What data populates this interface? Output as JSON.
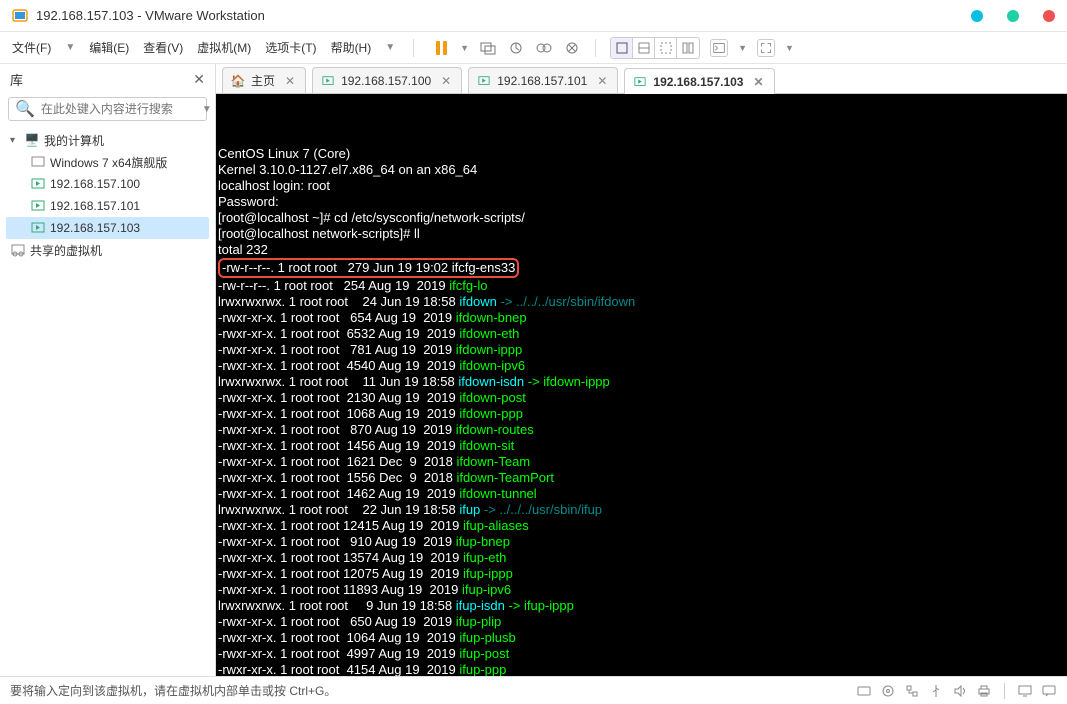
{
  "title": "192.168.157.103 - VMware Workstation",
  "menu": {
    "file": "文件(F)",
    "edit": "编辑(E)",
    "view": "查看(V)",
    "vm": "虚拟机(M)",
    "tabs": "选项卡(T)",
    "help": "帮助(H)"
  },
  "sidebar": {
    "title": "库",
    "search_placeholder": "在此处键入内容进行搜索",
    "nodes": {
      "my_computer": "我的计算机",
      "win7": "Windows 7 x64旗舰版",
      "n100": "192.168.157.100",
      "n101": "192.168.157.101",
      "n103": "192.168.157.103",
      "shared": "共享的虚拟机"
    }
  },
  "tabs": {
    "home": "主页",
    "t100": "192.168.157.100",
    "t101": "192.168.157.101",
    "t103": "192.168.157.103"
  },
  "terminal": {
    "l1": "CentOS Linux 7 (Core)",
    "l2": "Kernel 3.10.0-1127.el7.x86_64 on an x86_64",
    "l3": "",
    "l4": "localhost login: root",
    "l5": "Password:",
    "l6": "[root@localhost ~]# cd /etc/sysconfig/network-scripts/",
    "l7": "[root@localhost network-scripts]# ll",
    "l8": "total 232",
    "hl": "-rw-r--r--. 1 root root   279 Jun 19 19:02 ifcfg-ens33",
    "rows": [
      {
        "a": "-rw-r--r--. 1 root root   254 Aug 19  2019 ",
        "b": "ifcfg-lo",
        "c": "",
        "cls": "c-green"
      },
      {
        "a": "lrwxrwxrwx. 1 root root    24 Jun 19 18:58 ",
        "b": "ifdown",
        "c": " -> ../../../usr/sbin/ifdown",
        "cls": "c-cyan",
        "ccls": "c-darkcyan"
      },
      {
        "a": "-rwxr-xr-x. 1 root root   654 Aug 19  2019 ",
        "b": "ifdown-bnep",
        "c": "",
        "cls": "c-green"
      },
      {
        "a": "-rwxr-xr-x. 1 root root  6532 Aug 19  2019 ",
        "b": "ifdown-eth",
        "c": "",
        "cls": "c-green"
      },
      {
        "a": "-rwxr-xr-x. 1 root root   781 Aug 19  2019 ",
        "b": "ifdown-ippp",
        "c": "",
        "cls": "c-green"
      },
      {
        "a": "-rwxr-xr-x. 1 root root  4540 Aug 19  2019 ",
        "b": "ifdown-ipv6",
        "c": "",
        "cls": "c-green"
      },
      {
        "a": "lrwxrwxrwx. 1 root root    11 Jun 19 18:58 ",
        "b": "ifdown-isdn",
        "c": " -> ifdown-ippp",
        "cls": "c-cyan",
        "ccls": "c-green"
      },
      {
        "a": "-rwxr-xr-x. 1 root root  2130 Aug 19  2019 ",
        "b": "ifdown-post",
        "c": "",
        "cls": "c-green"
      },
      {
        "a": "-rwxr-xr-x. 1 root root  1068 Aug 19  2019 ",
        "b": "ifdown-ppp",
        "c": "",
        "cls": "c-green"
      },
      {
        "a": "-rwxr-xr-x. 1 root root   870 Aug 19  2019 ",
        "b": "ifdown-routes",
        "c": "",
        "cls": "c-green"
      },
      {
        "a": "-rwxr-xr-x. 1 root root  1456 Aug 19  2019 ",
        "b": "ifdown-sit",
        "c": "",
        "cls": "c-green"
      },
      {
        "a": "-rwxr-xr-x. 1 root root  1621 Dec  9  2018 ",
        "b": "ifdown-Team",
        "c": "",
        "cls": "c-green"
      },
      {
        "a": "-rwxr-xr-x. 1 root root  1556 Dec  9  2018 ",
        "b": "ifdown-TeamPort",
        "c": "",
        "cls": "c-green"
      },
      {
        "a": "-rwxr-xr-x. 1 root root  1462 Aug 19  2019 ",
        "b": "ifdown-tunnel",
        "c": "",
        "cls": "c-green"
      },
      {
        "a": "lrwxrwxrwx. 1 root root    22 Jun 19 18:58 ",
        "b": "ifup",
        "c": " -> ../../../usr/sbin/ifup",
        "cls": "c-cyan",
        "ccls": "c-darkcyan"
      },
      {
        "a": "-rwxr-xr-x. 1 root root 12415 Aug 19  2019 ",
        "b": "ifup-aliases",
        "c": "",
        "cls": "c-green"
      },
      {
        "a": "-rwxr-xr-x. 1 root root   910 Aug 19  2019 ",
        "b": "ifup-bnep",
        "c": "",
        "cls": "c-green"
      },
      {
        "a": "-rwxr-xr-x. 1 root root 13574 Aug 19  2019 ",
        "b": "ifup-eth",
        "c": "",
        "cls": "c-green"
      },
      {
        "a": "-rwxr-xr-x. 1 root root 12075 Aug 19  2019 ",
        "b": "ifup-ippp",
        "c": "",
        "cls": "c-green"
      },
      {
        "a": "-rwxr-xr-x. 1 root root 11893 Aug 19  2019 ",
        "b": "ifup-ipv6",
        "c": "",
        "cls": "c-green"
      },
      {
        "a": "lrwxrwxrwx. 1 root root     9 Jun 19 18:58 ",
        "b": "ifup-isdn",
        "c": " -> ifup-ippp",
        "cls": "c-cyan",
        "ccls": "c-green"
      },
      {
        "a": "-rwxr-xr-x. 1 root root   650 Aug 19  2019 ",
        "b": "ifup-plip",
        "c": "",
        "cls": "c-green"
      },
      {
        "a": "-rwxr-xr-x. 1 root root  1064 Aug 19  2019 ",
        "b": "ifup-plusb",
        "c": "",
        "cls": "c-green"
      },
      {
        "a": "-rwxr-xr-x. 1 root root  4997 Aug 19  2019 ",
        "b": "ifup-post",
        "c": "",
        "cls": "c-green"
      },
      {
        "a": "-rwxr-xr-x. 1 root root  4154 Aug 19  2019 ",
        "b": "ifup-ppp",
        "c": "",
        "cls": "c-green"
      }
    ]
  },
  "statusbar": {
    "text": "要将输入定向到该虚拟机，请在虚拟机内部单击或按 Ctrl+G。"
  }
}
